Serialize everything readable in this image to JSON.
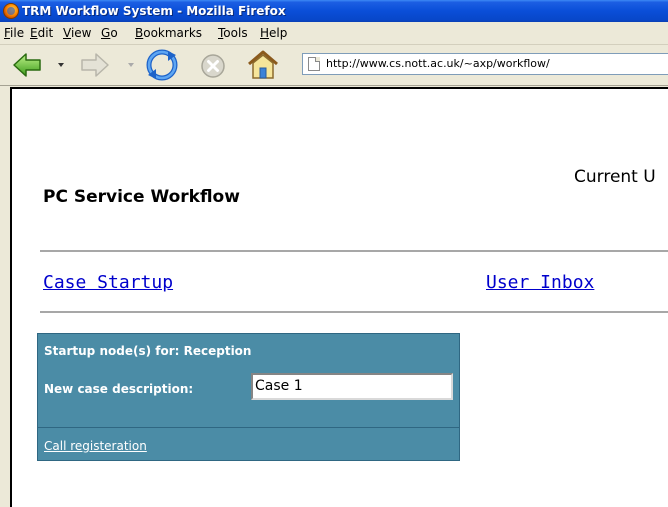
{
  "window": {
    "title": "TRM Workflow System - Mozilla Firefox"
  },
  "menu": [
    {
      "label": "File",
      "accel": "F",
      "rest": "ile"
    },
    {
      "label": "Edit",
      "accel": "E",
      "rest": "dit"
    },
    {
      "label": "View",
      "accel": "V",
      "rest": "iew"
    },
    {
      "label": "Go",
      "accel": "G",
      "rest": "o"
    },
    {
      "label": "Bookmarks",
      "accel": "B",
      "rest": "ookmarks"
    },
    {
      "label": "Tools",
      "accel": "T",
      "rest": "ools"
    },
    {
      "label": "Help",
      "accel": "H",
      "rest": "elp"
    }
  ],
  "toolbar": {
    "back_icon": "back-arrow-icon",
    "forward_icon": "forward-arrow-icon",
    "reload_icon": "reload-icon",
    "stop_icon": "stop-icon",
    "home_icon": "home-icon",
    "url": "http://www.cs.nott.ac.uk/~axp/workflow/"
  },
  "page": {
    "title": "PC Service Workflow",
    "current_user_label": "Current U",
    "nav": {
      "case_startup": "Case Startup",
      "user_inbox": "User Inbox"
    },
    "startup": {
      "heading": "Startup node(s) for: Reception",
      "desc_label": "New case description:",
      "desc_value": "Case 1",
      "call_link": "Call registeration"
    }
  },
  "colors": {
    "titlebar": "#0a4ed8",
    "panel_bg": "#4b8ca6",
    "link": "#0000cc"
  }
}
